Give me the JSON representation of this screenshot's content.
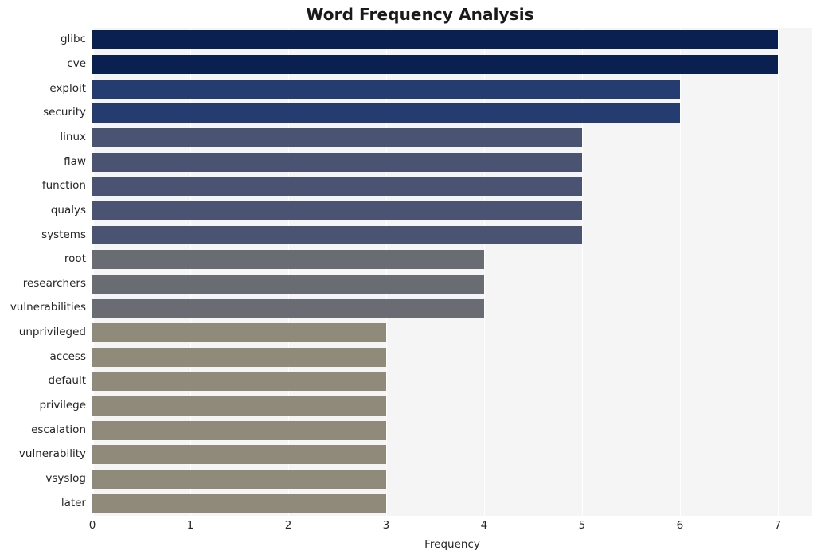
{
  "chart_data": {
    "type": "bar",
    "orientation": "horizontal",
    "title": "Word Frequency Analysis",
    "xlabel": "Frequency",
    "ylabel": "",
    "xlim": [
      0,
      7.35
    ],
    "xticks": [
      "0",
      "1",
      "2",
      "3",
      "4",
      "5",
      "6",
      "7"
    ],
    "xtick_values": [
      0,
      1,
      2,
      3,
      4,
      5,
      6,
      7
    ],
    "grid": "vertical-white-on-gray",
    "legend": "none",
    "categories": [
      "glibc",
      "cve",
      "exploit",
      "security",
      "linux",
      "flaw",
      "function",
      "qualys",
      "systems",
      "root",
      "researchers",
      "vulnerabilities",
      "unprivileged",
      "access",
      "default",
      "privilege",
      "escalation",
      "vulnerability",
      "vsyslog",
      "later"
    ],
    "values": [
      7,
      7,
      6,
      6,
      5,
      5,
      5,
      5,
      5,
      4,
      4,
      4,
      3,
      3,
      3,
      3,
      3,
      3,
      3,
      3
    ],
    "bar_colors": [
      "#0a2050",
      "#0a2050",
      "#253c70",
      "#253c70",
      "#4a5371",
      "#4a5371",
      "#4a5371",
      "#4a5371",
      "#4a5371",
      "#6a6c73",
      "#6a6c73",
      "#6a6c73",
      "#908a7a",
      "#908a7a",
      "#908a7a",
      "#908a7a",
      "#908a7a",
      "#908a7a",
      "#908a7a",
      "#908a7a"
    ]
  },
  "colors": {
    "plot_background": "#f5f5f6",
    "figure_background": "#ffffff",
    "gridline": "#ffffff",
    "text": "#262626",
    "title": "#1a1a1a"
  }
}
